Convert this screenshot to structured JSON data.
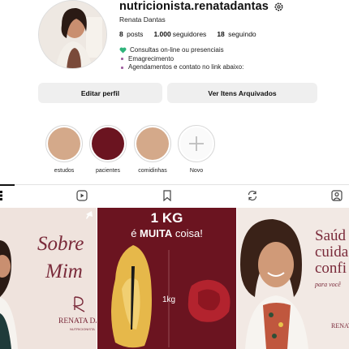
{
  "profile": {
    "username": "nutricionista.renatadantas",
    "full_name": "Renata Dantas",
    "stats": {
      "posts_value": "8",
      "posts_label": "posts",
      "followers_value": "1.000",
      "followers_label": "seguidores",
      "following_value": "18",
      "following_label": "seguindo"
    },
    "bio": {
      "line1": "Consultas on-line ou presenciais",
      "line2": "Emagrecimento",
      "line3": "Agendamentos e contato no link abaixo:"
    }
  },
  "buttons": {
    "edit": "Editar perfil",
    "archive": "Ver Itens Arquivados"
  },
  "highlights": [
    {
      "label": "estudos",
      "color": "#d4a98a"
    },
    {
      "label": "pacientes",
      "color": "#6b1420"
    },
    {
      "label": "comidinhas",
      "color": "#d4a98a"
    },
    {
      "label": "Novo",
      "color": ""
    }
  ],
  "tabs": [
    "grid-icon",
    "reels-icon",
    "saved-icon",
    "tagged-collab-icon",
    "tagged-icon"
  ],
  "posts": {
    "post1": {
      "title_line1": "Sobre",
      "title_line2": "Mim",
      "brand": "RENATA DANTAS",
      "brand_sub": "NUTRICIONISTA"
    },
    "post2": {
      "headline_num": "1 KG",
      "headline_a": "é ",
      "headline_b": "MUITA",
      "headline_c": " coisa!",
      "label": "1kg"
    },
    "post3": {
      "title_line1": "Saúd",
      "title_line2": "cuida",
      "title_line3": "confi",
      "tagline": "para você",
      "brand": "RENATA"
    }
  },
  "colors": {
    "accent_wine": "#6b1420",
    "button_bg": "#efefef",
    "verified": "#111111",
    "bio_heart": "#2fb37b"
  }
}
